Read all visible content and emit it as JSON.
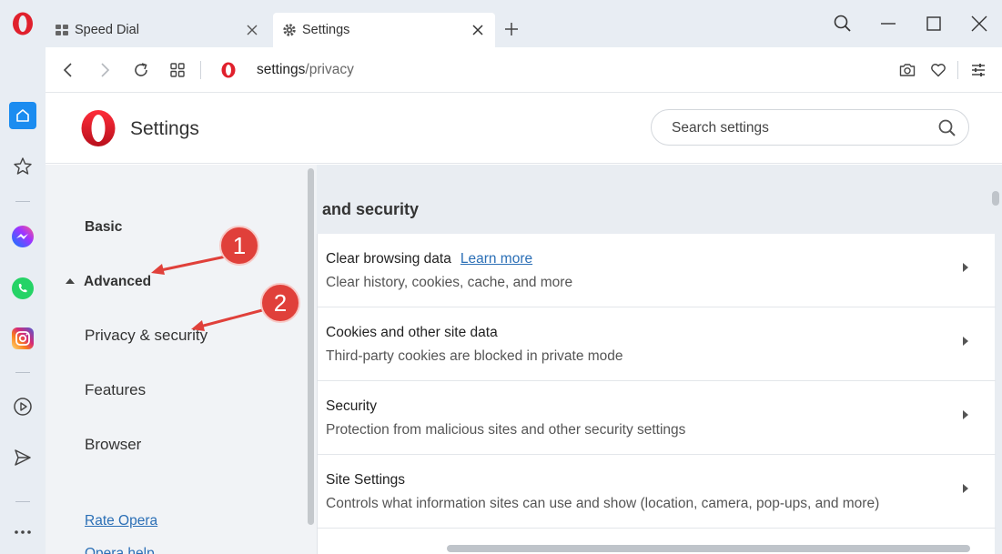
{
  "tabs": [
    {
      "label": "Speed Dial",
      "icon": "speed-dial-icon"
    },
    {
      "label": "Settings",
      "icon": "gear-icon",
      "active": true
    }
  ],
  "address": {
    "host": "settings",
    "path": "/privacy"
  },
  "settings": {
    "title": "Settings",
    "search_placeholder": "Search settings"
  },
  "nav": {
    "basic": "Basic",
    "advanced": "Advanced",
    "privacy": "Privacy & security",
    "features": "Features",
    "browser": "Browser",
    "rate": "Rate Opera",
    "open": "Opera help"
  },
  "section": {
    "title": "and security",
    "rows": [
      {
        "title": "Clear browsing data",
        "link": "Learn more",
        "subtitle": "Clear history, cookies, cache, and more"
      },
      {
        "title": "Cookies and other site data",
        "subtitle": "Third-party cookies are blocked in private mode"
      },
      {
        "title": "Security",
        "subtitle": "Protection from malicious sites and other security settings"
      },
      {
        "title": "Site Settings",
        "subtitle": "Controls what information sites can use and show (location, camera, pop-ups, and more)"
      }
    ]
  },
  "annotations": [
    {
      "number": "1"
    },
    {
      "number": "2"
    }
  ],
  "colors": {
    "opera_red": "#e0202c",
    "accent_blue": "#1a73e8",
    "link": "#2b6fb6",
    "annotation_red": "#e0403a"
  }
}
